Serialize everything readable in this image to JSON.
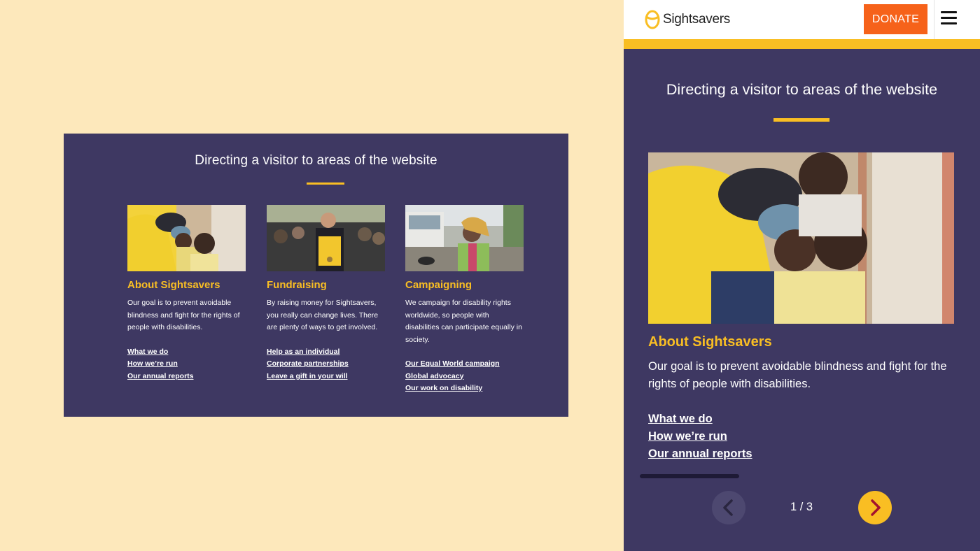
{
  "desktop": {
    "title": "Directing a visitor to areas of the website",
    "cards": [
      {
        "heading": "About Sightsavers",
        "body": "Our goal is to prevent avoidable blindness and fight for the rights of people with disabilities.",
        "links": [
          "What we do",
          "How we’re run",
          "Our annual reports"
        ]
      },
      {
        "heading": "Fundraising",
        "body": "By raising money for Sightsavers, you really can change lives. There are plenty of ways to get involved.",
        "links": [
          "Help as an individual",
          "Corporate partnerships",
          "Leave a gift in your will"
        ]
      },
      {
        "heading": "Campaigning",
        "body": "We campaign for disability rights worldwide, so people with disabilities can participate equally in society.",
        "links": [
          "Our Equal World campaign",
          "Global advocacy",
          "Our work on disability"
        ]
      }
    ]
  },
  "mobile": {
    "brand": "Sightsavers",
    "donate_label": "DONATE",
    "title": "Directing a visitor to areas of the website",
    "card": {
      "heading": "About Sightsavers",
      "body": "Our goal is to prevent avoidable blindness and fight for the rights of people with disabilities.",
      "links": [
        "What we do",
        "How we’re run",
        "Our annual reports"
      ]
    },
    "pager": "1 / 3",
    "icons": {
      "logo": "sightsavers-logo-icon",
      "menu": "hamburger-menu-icon",
      "prev": "chevron-left-icon",
      "next": "chevron-right-icon"
    }
  },
  "colors": {
    "background": "#fde8bb",
    "panel": "#3e3862",
    "accent": "#f9be23",
    "donate": "#f6621a"
  }
}
